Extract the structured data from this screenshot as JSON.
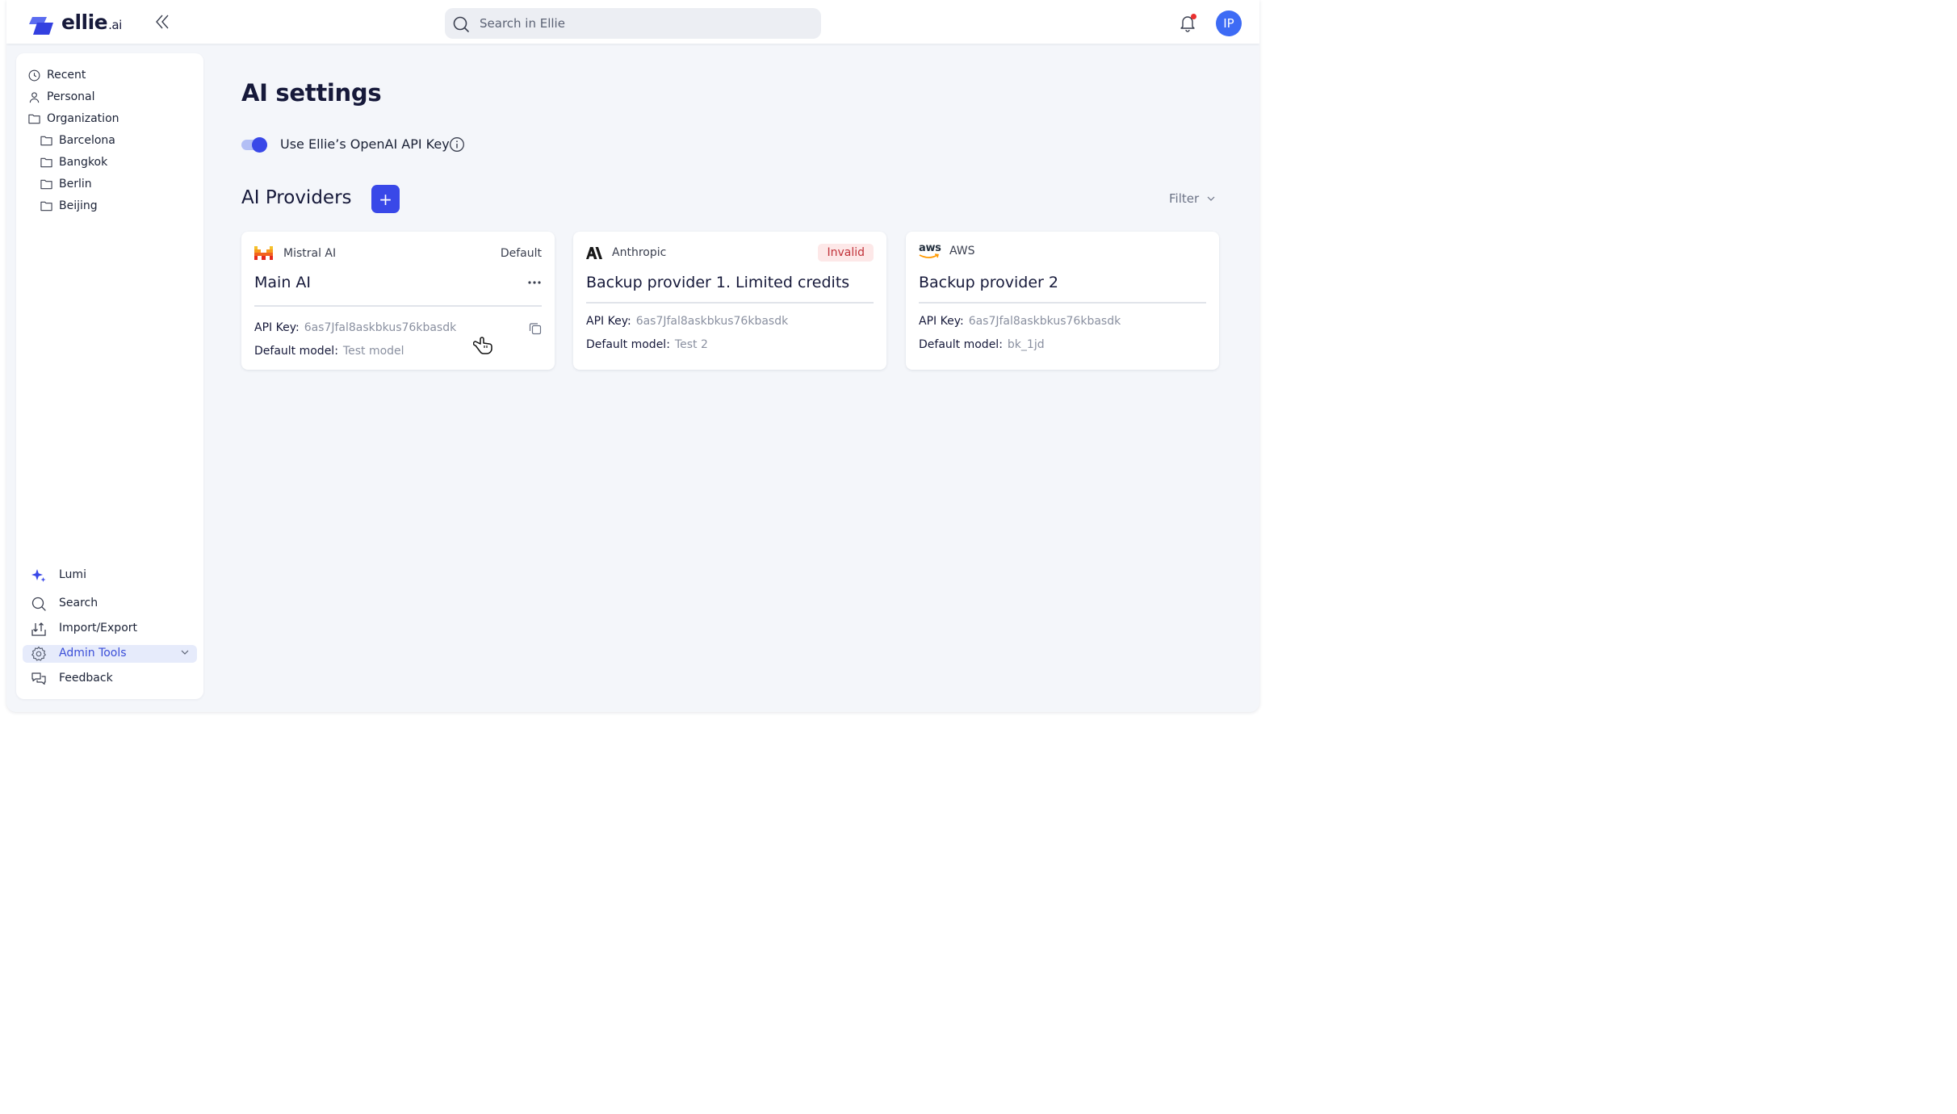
{
  "header": {
    "logo_text": "ellie",
    "logo_suffix": ".ai",
    "search_placeholder": "Search in Ellie",
    "avatar_initials": "IP",
    "notification_dot_color": "#ea2f2f"
  },
  "sidebar": {
    "items": [
      {
        "label": "Recent",
        "icon": "clock-icon"
      },
      {
        "label": "Personal",
        "icon": "user-icon"
      },
      {
        "label": "Organization",
        "icon": "folder-icon"
      },
      {
        "label": "Barcelona",
        "icon": "folder-icon"
      },
      {
        "label": "Bangkok",
        "icon": "folder-icon"
      },
      {
        "label": "Berlin",
        "icon": "folder-icon"
      },
      {
        "label": "Beijing",
        "icon": "folder-icon"
      }
    ],
    "bottom_items": [
      {
        "label": "Lumi",
        "icon": "sparkle-icon"
      },
      {
        "label": "Search",
        "icon": "search-icon"
      },
      {
        "label": "Import/Export",
        "icon": "import-export-icon"
      },
      {
        "label": "Admin Tools",
        "icon": "gear-icon",
        "active": true
      },
      {
        "label": "Feedback",
        "icon": "feedback-icon"
      }
    ]
  },
  "main": {
    "title": "AI settings",
    "toggle_label": "Use Ellie’s OpenAI API Key",
    "toggle_on": true,
    "providers_title": "AI Providers",
    "add_button_label": "+",
    "filter_label": "Filter",
    "accent_color": "#3948e8",
    "cards": [
      {
        "provider": "Mistral AI",
        "tag": "Default",
        "title": "Main AI",
        "api_key_label": "API Key:",
        "api_key": "6as7Jfal8askbkus76kbasdk",
        "model_label": "Default model:",
        "model": "Test model"
      },
      {
        "provider": "Anthropic",
        "tag": "Invalid",
        "title": "Backup provider 1. Limited credits",
        "api_key_label": "API Key:",
        "api_key": "6as7Jfal8askbkus76kbasdk",
        "model_label": "Default model:",
        "model": "Test 2"
      },
      {
        "provider": "AWS",
        "logo_text": "aws",
        "title": "Backup provider 2",
        "api_key_label": "API Key:",
        "api_key": "6as7Jfal8askbkus76kbasdk",
        "model_label": "Default model:",
        "model": "bk_1jd"
      }
    ]
  }
}
